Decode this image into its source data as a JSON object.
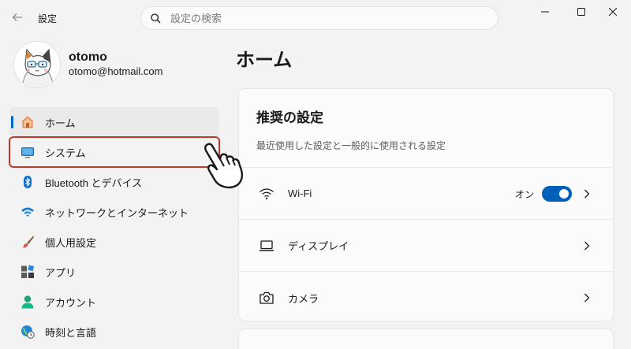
{
  "titlebar": {
    "back_icon": "arrow-left-icon",
    "title": "設定",
    "minimize_icon": "minimize-icon",
    "maximize_icon": "maximize-icon",
    "close_icon": "close-icon"
  },
  "search": {
    "placeholder": "設定の検索",
    "value": "",
    "icon": "search-icon"
  },
  "profile": {
    "name": "otomo",
    "email": "otomo@hotmail.com"
  },
  "sidebar": {
    "items": [
      {
        "label": "ホーム",
        "icon": "home-icon",
        "active": true
      },
      {
        "label": "システム",
        "icon": "monitor-icon",
        "highlighted": true
      },
      {
        "label": "Bluetooth とデバイス",
        "icon": "bluetooth-icon"
      },
      {
        "label": "ネットワークとインターネット",
        "icon": "wifi-icon"
      },
      {
        "label": "個人用設定",
        "icon": "paintbrush-icon"
      },
      {
        "label": "アプリ",
        "icon": "apps-icon"
      },
      {
        "label": "アカウント",
        "icon": "account-icon"
      },
      {
        "label": "時刻と言語",
        "icon": "globe-clock-icon"
      }
    ]
  },
  "main": {
    "title": "ホーム",
    "recommended": {
      "title": "推奨の設定",
      "subtitle": "最近使用した設定と一般的に使用される設定",
      "rows": [
        {
          "label": "Wi-Fi",
          "icon": "wifi-icon",
          "toggle_text": "オン",
          "toggle_on": true
        },
        {
          "label": "ディスプレイ",
          "icon": "laptop-icon"
        },
        {
          "label": "カメラ",
          "icon": "camera-icon"
        }
      ]
    }
  },
  "colors": {
    "accent": "#0067c0",
    "highlight_border": "#c0392b",
    "toggle_on": "#005fb8"
  }
}
